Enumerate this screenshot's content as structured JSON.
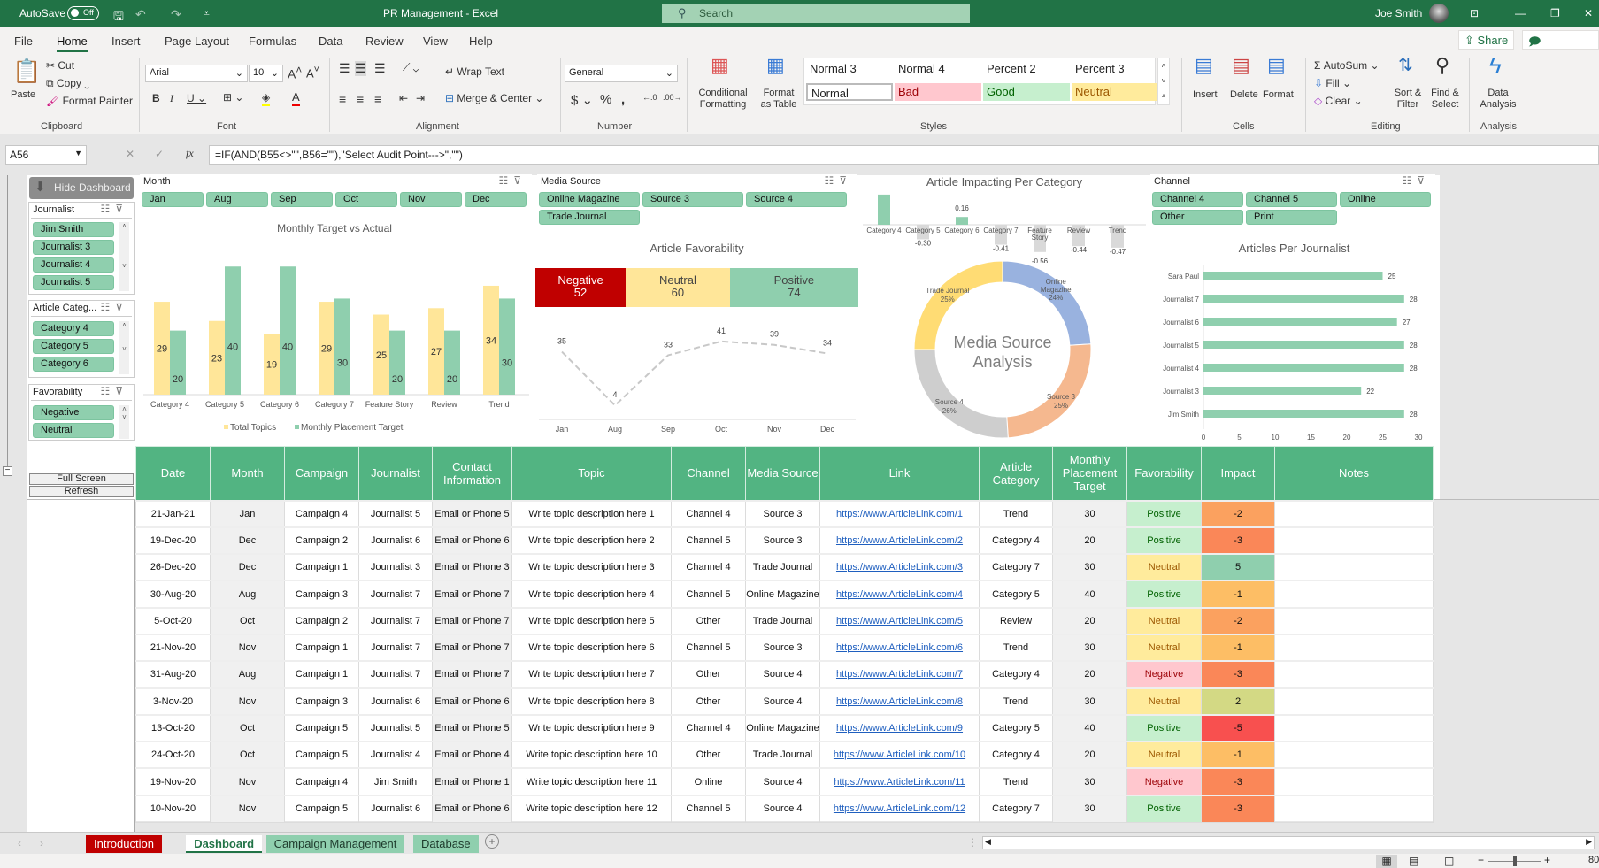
{
  "titlebar": {
    "autosave_label": "AutoSave",
    "autosave_state": "Off",
    "doc_title": "PR Management  -  Excel",
    "search_placeholder": "Search",
    "user_name": "Joe Smith"
  },
  "menu": {
    "tabs": [
      "File",
      "Home",
      "Insert",
      "Page Layout",
      "Formulas",
      "Data",
      "Review",
      "View",
      "Help"
    ],
    "active": "Home",
    "share": "Share",
    "comments": "Comments"
  },
  "ribbon": {
    "clipboard": {
      "paste": "Paste",
      "cut": "Cut",
      "copy": "Copy",
      "format_painter": "Format Painter",
      "label": "Clipboard"
    },
    "font": {
      "name": "Arial",
      "size": "10",
      "label": "Font"
    },
    "alignment": {
      "wrap": "Wrap Text",
      "merge": "Merge & Center",
      "label": "Alignment"
    },
    "number": {
      "format": "General",
      "label": "Number"
    },
    "styles": {
      "conditional": "Conditional Formatting",
      "format_table": "Format as Table",
      "cells": [
        {
          "name": "Normal 3"
        },
        {
          "name": "Normal 4"
        },
        {
          "name": "Percent 2"
        },
        {
          "name": "Percent 3"
        },
        {
          "name": "Normal"
        },
        {
          "name": "Bad"
        },
        {
          "name": "Good"
        },
        {
          "name": "Neutral"
        }
      ],
      "label": "Styles"
    },
    "cells": {
      "insert": "Insert",
      "delete": "Delete",
      "format": "Format",
      "label": "Cells"
    },
    "editing": {
      "autosum": "AutoSum",
      "fill": "Fill",
      "clear": "Clear",
      "sort": "Sort & Filter",
      "find": "Find & Select",
      "label": "Editing"
    },
    "analysis": {
      "data_analysis": "Data Analysis",
      "label": "Analysis"
    }
  },
  "formula_bar": {
    "name_box": "A56",
    "formula": "=IF(AND(B55<>\"\",B56=\"\"),\"Select Audit Point--->\",\"\")"
  },
  "sidebar": {
    "hide_dashboard": "Hide Dashboard",
    "journalist": {
      "title": "Journalist",
      "items": [
        "Jim Smith",
        "Journalist 3",
        "Journalist 4",
        "Journalist 5"
      ]
    },
    "category": {
      "title": "Article Categ...",
      "items": [
        "Category 4",
        "Category 5",
        "Category 6"
      ]
    },
    "favorability": {
      "title": "Favorability",
      "items": [
        "Negative",
        "Neutral"
      ]
    },
    "full_screen": "Full Screen",
    "refresh": "Refresh"
  },
  "slicers": {
    "month": {
      "title": "Month",
      "items": [
        "Jan",
        "Aug",
        "Sep",
        "Oct",
        "Nov",
        "Dec"
      ]
    },
    "media_source": {
      "title": "Media Source",
      "items": [
        "Online Magazine",
        "Source 3",
        "Source 4",
        "Trade Journal"
      ]
    },
    "channel": {
      "title": "Channel",
      "items": [
        "Channel 4",
        "Channel 5",
        "Online",
        "Other",
        "Print"
      ]
    }
  },
  "favorability_summary": {
    "title": "Article Favorability",
    "segments": [
      {
        "label": "Negative",
        "value": 52,
        "color": "#c00000"
      },
      {
        "label": "Neutral",
        "value": 60,
        "color": "#ffe699"
      },
      {
        "label": "Positive",
        "value": 74,
        "color": "#8fcfae"
      }
    ]
  },
  "chart_data": [
    {
      "type": "bar",
      "title": "Monthly Target vs Actual",
      "categories": [
        "Category 4",
        "Category 5",
        "Category 6",
        "Category 7",
        "Feature Story",
        "Review",
        "Trend"
      ],
      "series": [
        {
          "name": "Total Topics",
          "values": [
            29,
            23,
            19,
            29,
            25,
            27,
            34
          ],
          "color": "#ffe699"
        },
        {
          "name": "Monthly Placement Target",
          "values": [
            20,
            40,
            40,
            30,
            20,
            20,
            30
          ],
          "color": "#8fcfae"
        }
      ],
      "ylim": [
        0,
        42
      ],
      "legend": "bottom",
      "grid": false
    },
    {
      "type": "line",
      "title": "",
      "categories": [
        "Jan",
        "Aug",
        "Sep",
        "Oct",
        "Nov",
        "Dec"
      ],
      "values": [
        35,
        4,
        33,
        41,
        39,
        34
      ],
      "ylim": [
        0,
        45
      ],
      "style": "dashed"
    },
    {
      "type": "bar",
      "title": "Article Impacting Per Category",
      "categories": [
        "Category 4",
        "Category 5",
        "Category 6",
        "Category 7",
        "Feature Story",
        "Review",
        "Trend"
      ],
      "values": [
        0.62,
        -0.3,
        0.16,
        -0.41,
        -0.56,
        -0.44,
        -0.47
      ],
      "ylim": [
        -0.7,
        0.7
      ]
    },
    {
      "type": "pie",
      "title": "Media Source Analysis",
      "labels": [
        "Online Magazine",
        "Source 3",
        "Source 4",
        "Trade Journal"
      ],
      "values": [
        24,
        25,
        26,
        25
      ],
      "colors": [
        "#8faadc",
        "#f4b183",
        "#c9c9c9",
        "#ffd966"
      ],
      "donut": true
    },
    {
      "type": "bar",
      "orientation": "horizontal",
      "title": "Articles Per Journalist",
      "categories": [
        "Sara Paul",
        "Journalist 7",
        "Journalist 6",
        "Journalist 5",
        "Journalist 4",
        "Journalist 3",
        "Jim Smith"
      ],
      "values": [
        25,
        28,
        27,
        28,
        28,
        22,
        28
      ],
      "xlim": [
        0,
        30
      ],
      "xticks": [
        0,
        5,
        10,
        15,
        20,
        25,
        30
      ]
    }
  ],
  "table": {
    "headers": [
      "Date",
      "Month",
      "Campaign",
      "Journalist",
      "Contact Information",
      "Topic",
      "Channel",
      "Media Source",
      "Link",
      "Article Category",
      "Monthly Placement Target",
      "Favorability",
      "Impact",
      "Notes"
    ],
    "rows": [
      [
        "21-Jan-21",
        "Jan",
        "Campaign 4",
        "Journalist 5",
        "Email or Phone 5",
        "Write topic description here 1",
        "Channel 4",
        "Source 3",
        "https://www.ArticleLink.com/1",
        "Trend",
        "30",
        "Positive",
        "-2",
        ""
      ],
      [
        "19-Dec-20",
        "Dec",
        "Campaign 2",
        "Journalist 6",
        "Email or Phone 6",
        "Write topic description here 2",
        "Channel 5",
        "Source 3",
        "https://www.ArticleLink.com/2",
        "Category 4",
        "20",
        "Positive",
        "-3",
        ""
      ],
      [
        "26-Dec-20",
        "Dec",
        "Campaign 1",
        "Journalist 3",
        "Email or Phone 3",
        "Write topic description here 3",
        "Channel 4",
        "Trade Journal",
        "https://www.ArticleLink.com/3",
        "Category 7",
        "30",
        "Neutral",
        "5",
        ""
      ],
      [
        "30-Aug-20",
        "Aug",
        "Campaign 3",
        "Journalist 7",
        "Email or Phone 7",
        "Write topic description here 4",
        "Channel 5",
        "Online Magazine",
        "https://www.ArticleLink.com/4",
        "Category 5",
        "40",
        "Positive",
        "-1",
        ""
      ],
      [
        "5-Oct-20",
        "Oct",
        "Campaign 2",
        "Journalist 7",
        "Email or Phone 7",
        "Write topic description here 5",
        "Other",
        "Trade Journal",
        "https://www.ArticleLink.com/5",
        "Review",
        "20",
        "Neutral",
        "-2",
        ""
      ],
      [
        "21-Nov-20",
        "Nov",
        "Campaign 1",
        "Journalist 7",
        "Email or Phone 7",
        "Write topic description here 6",
        "Channel 5",
        "Source 3",
        "https://www.ArticleLink.com/6",
        "Trend",
        "30",
        "Neutral",
        "-1",
        ""
      ],
      [
        "31-Aug-20",
        "Aug",
        "Campaign 1",
        "Journalist 7",
        "Email or Phone 7",
        "Write topic description here 7",
        "Other",
        "Source 4",
        "https://www.ArticleLink.com/7",
        "Category 4",
        "20",
        "Negative",
        "-3",
        ""
      ],
      [
        "3-Nov-20",
        "Nov",
        "Campaign 3",
        "Journalist 6",
        "Email or Phone 6",
        "Write topic description here 8",
        "Other",
        "Source 4",
        "https://www.ArticleLink.com/8",
        "Trend",
        "30",
        "Neutral",
        "2",
        ""
      ],
      [
        "13-Oct-20",
        "Oct",
        "Campaign 5",
        "Journalist 5",
        "Email or Phone 5",
        "Write topic description here 9",
        "Channel 4",
        "Online Magazine",
        "https://www.ArticleLink.com/9",
        "Category 5",
        "40",
        "Positive",
        "-5",
        ""
      ],
      [
        "24-Oct-20",
        "Oct",
        "Campaign 5",
        "Journalist 4",
        "Email or Phone 4",
        "Write topic description here 10",
        "Other",
        "Trade Journal",
        "https://www.ArticleLink.com/10",
        "Category 4",
        "20",
        "Neutral",
        "-1",
        ""
      ],
      [
        "19-Nov-20",
        "Nov",
        "Campaign 4",
        "Jim Smith",
        "Email or Phone 1",
        "Write topic description here 11",
        "Online",
        "Source 4",
        "https://www.ArticleLink.com/11",
        "Trend",
        "30",
        "Negative",
        "-3",
        ""
      ],
      [
        "10-Nov-20",
        "Nov",
        "Campaign 5",
        "Journalist 6",
        "Email or Phone 6",
        "Write topic description here 12",
        "Channel 5",
        "Source 4",
        "https://www.ArticleLink.com/12",
        "Category 7",
        "30",
        "Positive",
        "-3",
        ""
      ]
    ]
  },
  "fav_colors": {
    "Positive": {
      "bg": "#c6efce",
      "fg": "#006100"
    },
    "Neutral": {
      "bg": "#ffeb9c",
      "fg": "#9c5700"
    },
    "Negative": {
      "bg": "#ffc7ce",
      "fg": "#9c0006"
    }
  },
  "impact_colors": {
    "-5": "#f8504f",
    "-3": "#fa8758",
    "-2": "#fba15f",
    "-1": "#fdbe65",
    "2": "#d3d984",
    "5": "#8fcfae"
  },
  "sheet_tabs": [
    {
      "label": "Introduction",
      "bg": "#c00000",
      "fg": "#ffffff"
    },
    {
      "label": "Dashboard",
      "bg": "#ffffff",
      "fg": "#217346",
      "active": true
    },
    {
      "label": "Campaign Management",
      "bg": "#8fcfae",
      "fg": "#1e3a2c"
    },
    {
      "label": "Database",
      "bg": "#8fcfae",
      "fg": "#1e3a2c"
    }
  ],
  "status": {
    "zoom": "80"
  }
}
